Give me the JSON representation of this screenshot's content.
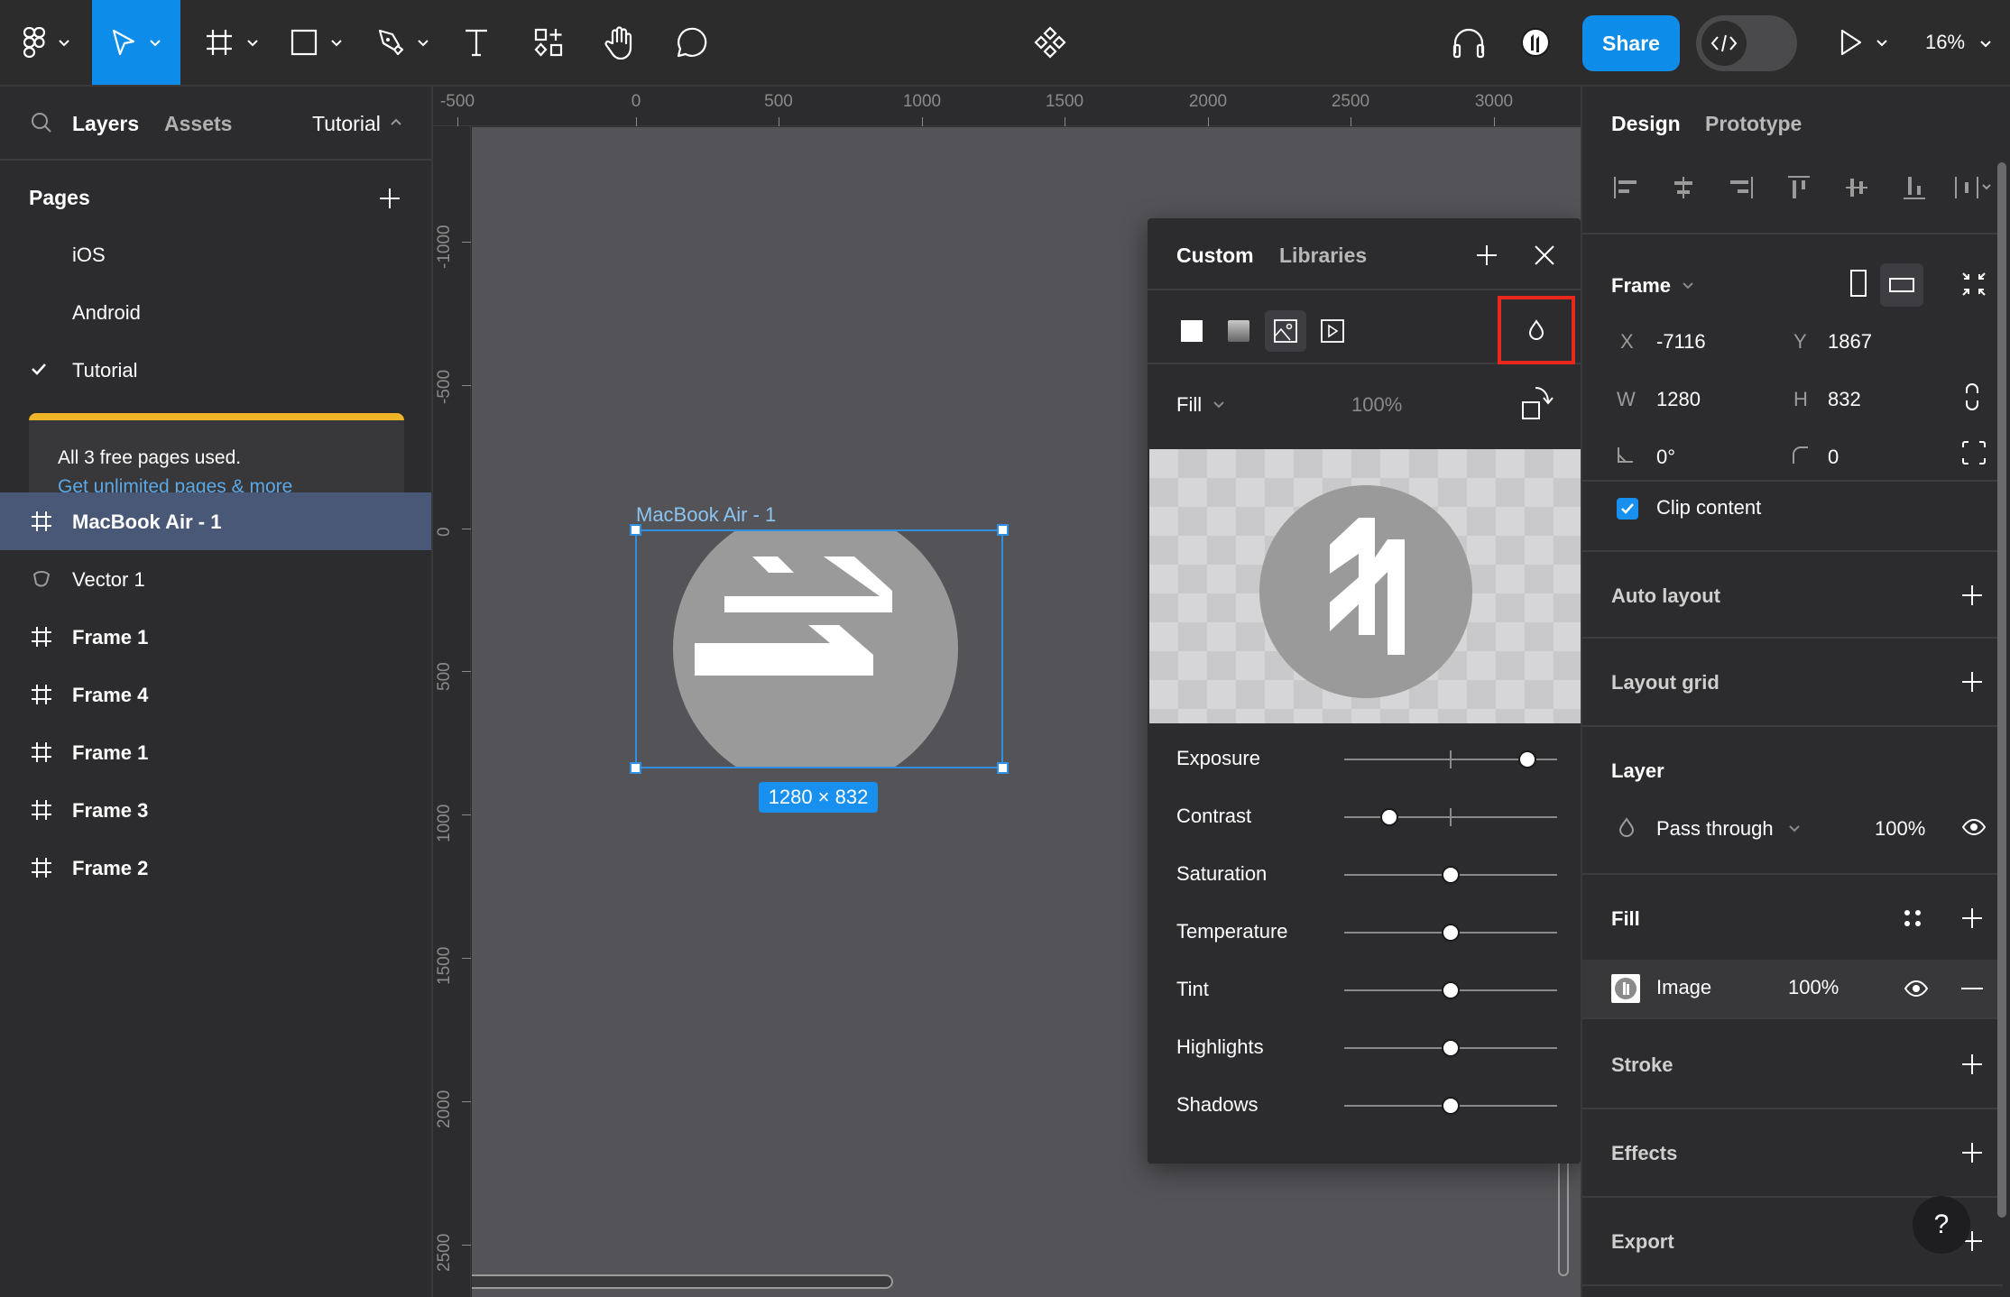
{
  "toolbar": {
    "tools": [
      "main-menu",
      "move",
      "frame",
      "shape",
      "pen",
      "text",
      "resources",
      "hand",
      "comment"
    ],
    "active_tool": "move",
    "center_icon": "components-icon",
    "share_label": "Share",
    "dev_mode_label": "</>",
    "zoom_level": "16%"
  },
  "left_panel": {
    "tabs": {
      "layers": "Layers",
      "assets": "Assets"
    },
    "page_selector": "Tutorial",
    "pages_heading": "Pages",
    "pages": [
      {
        "label": "iOS",
        "current": false
      },
      {
        "label": "Android",
        "current": false
      },
      {
        "label": "Tutorial",
        "current": true
      }
    ],
    "upsell": {
      "text": "All 3 free pages used.",
      "link": "Get unlimited pages & more"
    },
    "layers": [
      {
        "name": "MacBook Air - 1",
        "type": "frame",
        "selected": true
      },
      {
        "name": "Vector 1",
        "type": "vector",
        "selected": false
      },
      {
        "name": "Frame 1",
        "type": "frame",
        "selected": false
      },
      {
        "name": "Frame 4",
        "type": "frame",
        "selected": false
      },
      {
        "name": "Frame 1",
        "type": "frame",
        "selected": false
      },
      {
        "name": "Frame 3",
        "type": "frame",
        "selected": false
      },
      {
        "name": "Frame 2",
        "type": "frame",
        "selected": false
      }
    ]
  },
  "rulers": {
    "top": [
      "-500",
      "0",
      "500",
      "1000",
      "1500",
      "2000",
      "2500",
      "3000"
    ],
    "left": [
      "-1000",
      "-500",
      "0",
      "500",
      "1000",
      "1500",
      "2000",
      "2500"
    ]
  },
  "canvas": {
    "frame_name": "MacBook Air - 1",
    "frame_size": "1280 × 832"
  },
  "fill_popup": {
    "tabs": {
      "custom": "Custom",
      "libraries": "Libraries"
    },
    "fill_types": [
      "solid",
      "gradient",
      "image",
      "video"
    ],
    "active_fill_type": "image",
    "mode_label": "Fill",
    "opacity": "100%",
    "adjustments": [
      {
        "label": "Exposure",
        "value": 0.72,
        "bipolar": true
      },
      {
        "label": "Contrast",
        "value": -0.58,
        "bipolar": true
      },
      {
        "label": "Saturation",
        "value": 0,
        "bipolar": false
      },
      {
        "label": "Temperature",
        "value": 0,
        "bipolar": false
      },
      {
        "label": "Tint",
        "value": 0,
        "bipolar": false
      },
      {
        "label": "Highlights",
        "value": 0,
        "bipolar": false
      },
      {
        "label": "Shadows",
        "value": 0,
        "bipolar": false
      }
    ]
  },
  "right_panel": {
    "tabs": {
      "design": "Design",
      "prototype": "Prototype"
    },
    "frame_heading": "Frame",
    "x_label": "X",
    "x": "-7116",
    "y_label": "Y",
    "y": "1867",
    "w_label": "W",
    "w": "1280",
    "h_label": "H",
    "h": "832",
    "rotation": "0°",
    "corner_radius": "0",
    "clip_content_label": "Clip content",
    "clip_content": true,
    "auto_layout": "Auto layout",
    "layout_grid": "Layout grid",
    "layer_heading": "Layer",
    "blend_mode": "Pass through",
    "layer_opacity": "100%",
    "fill_heading": "Fill",
    "fill_type": "Image",
    "fill_opacity": "100%",
    "stroke": "Stroke",
    "effects": "Effects",
    "export": "Export",
    "help": "?"
  },
  "colors": {
    "accent": "#0d8ce9",
    "selection": "#2f8fe0",
    "highlight_box": "#e8281c",
    "upsell_bar": "#f0b429",
    "selected_layer": "#4a5878"
  }
}
